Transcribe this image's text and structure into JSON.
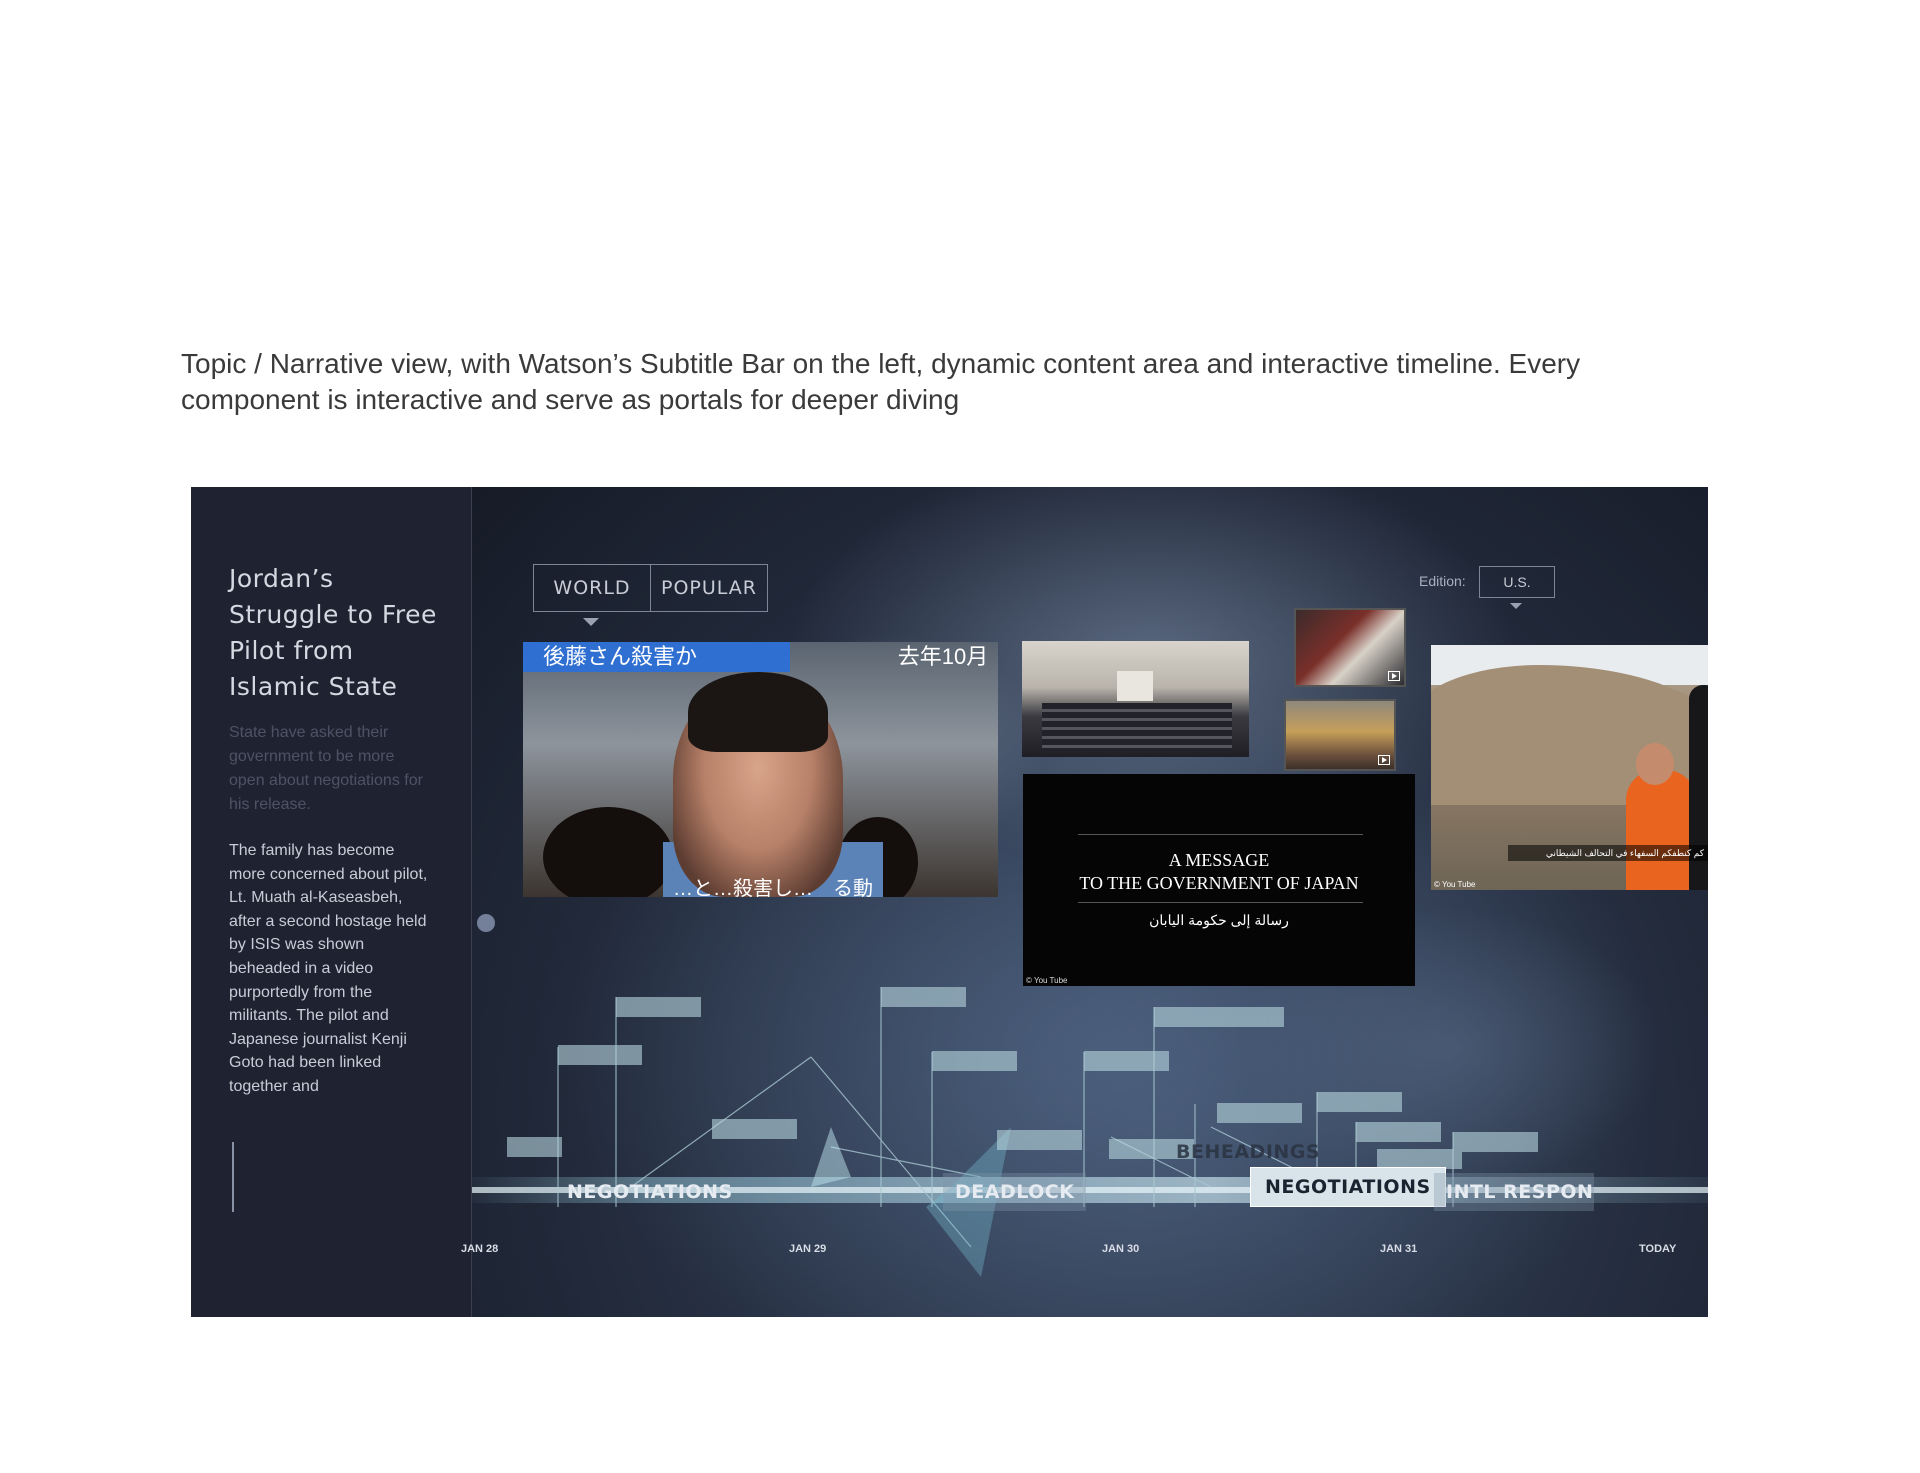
{
  "caption": {
    "line1": "Topic / Narrative view, with Watson’s Subtitle Bar on the left, dynamic content area and interactive timeline.  Every",
    "line2": "component is interactive and serve as portals for deeper diving"
  },
  "sidebar": {
    "title": "Jordan’s Struggle to Free Pilot from Islamic State",
    "faded_text": "State have asked their government to be more open about negotiations for his release.",
    "body_text": "The family has become more concerned about pilot, Lt. Muath al-Kaseasbeh, after a second hostage held by ISIS was shown beheaded in a video purportedly from the militants. The pilot and Japanese journalist Kenji Goto had been linked together and"
  },
  "tabs": [
    {
      "label": "WORLD"
    },
    {
      "label": "POPULAR"
    }
  ],
  "edition": {
    "label": "Edition:",
    "value": "U.S."
  },
  "media": {
    "main": {
      "banner_left": "後藤さん殺害か",
      "banner_right": "去年10月",
      "subtitle": "…と…殺害し…　る動"
    },
    "message": {
      "line1": "A MESSAGE",
      "line2": "TO THE GOVERNMENT OF JAPAN",
      "arabic": "رسالة إلى حكومة اليابان",
      "credit": "© You Tube"
    },
    "desert": {
      "arabic": "كم كنطفكم السفهاء في التحالف الشيطاني",
      "credit": "© You Tube"
    }
  },
  "timeline": {
    "events": [
      {
        "label": "NEGOTIATIONS",
        "state": "normal"
      },
      {
        "label": "DEADLOCK",
        "state": "boxed"
      },
      {
        "label": "BEHEADINGS",
        "state": "dim"
      },
      {
        "label": "NEGOTIATIONS",
        "state": "active"
      },
      {
        "label": "INTL RESPONSE",
        "state": "boxed"
      }
    ],
    "dates": [
      "JAN 28",
      "JAN 29",
      "JAN 30",
      "JAN 31",
      "TODAY"
    ]
  },
  "colors": {
    "frame_bg": "#1b1f2c",
    "active_event_bg": "#d9e3ea",
    "timeline_glow": "#9fd4e6",
    "marker_fill": "#b8d6de"
  }
}
